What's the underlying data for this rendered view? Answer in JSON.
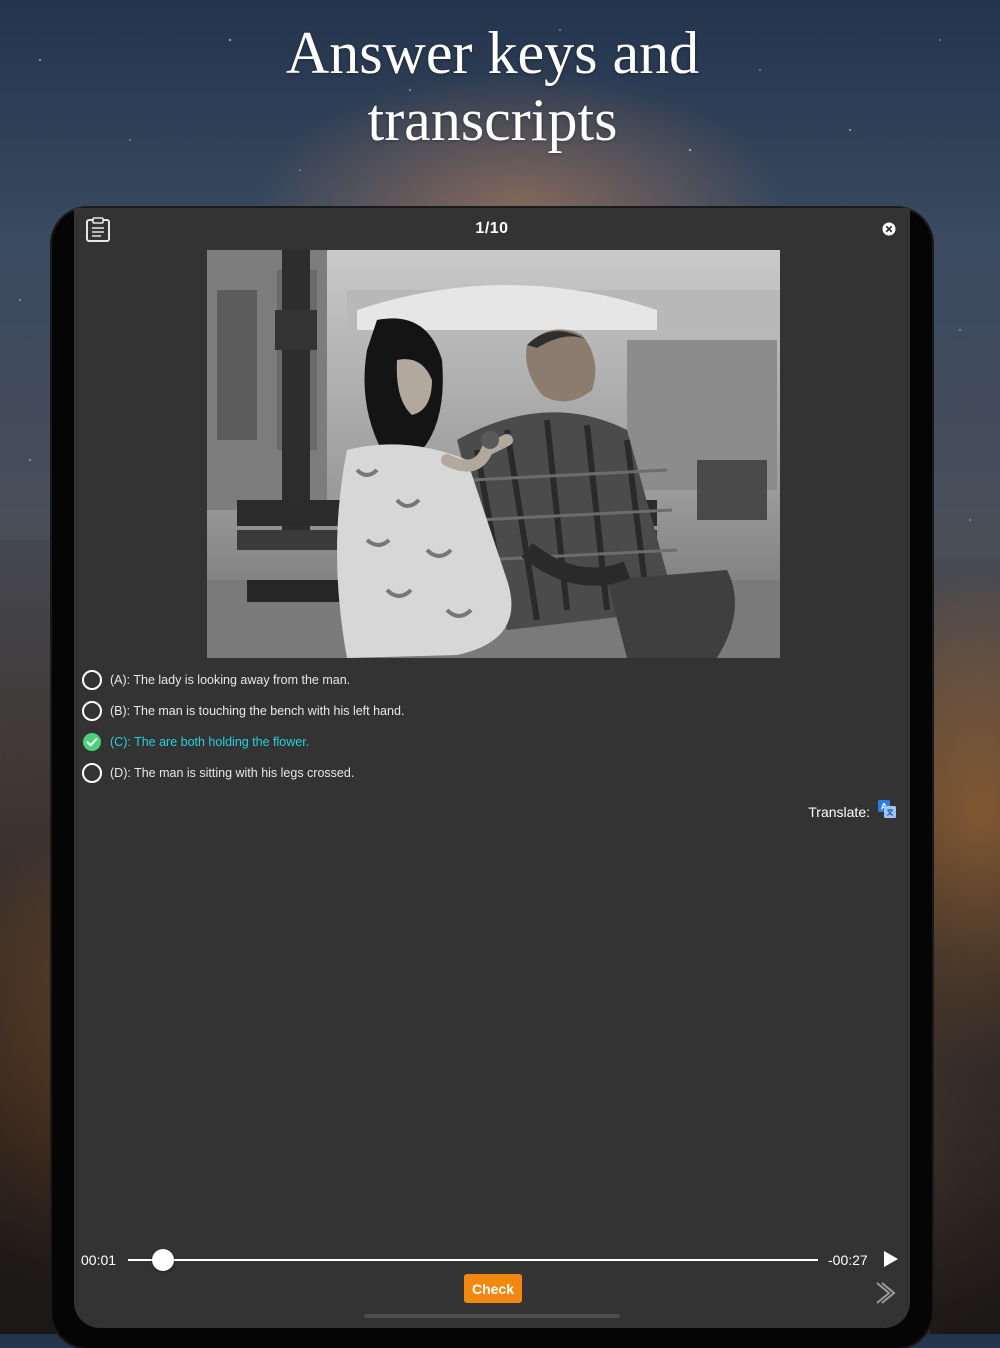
{
  "headline": {
    "line1": "Answer keys and",
    "line2": "transcripts"
  },
  "quiz": {
    "counter": "1/10",
    "photo_icon": "couple-on-bench-photo",
    "options": [
      {
        "label": "(A): The lady is looking away from the man.",
        "state": "unselected"
      },
      {
        "label": "(B): The man is touching the bench with his left hand.",
        "state": "unselected"
      },
      {
        "label": "(C): The are both holding the flower.",
        "state": "correct"
      },
      {
        "label": "(D): The man is sitting with his legs crossed.",
        "state": "unselected"
      }
    ],
    "translate_label": "Translate:"
  },
  "player": {
    "elapsed": "00:01",
    "remaining": "-00:27",
    "progress_fraction": 0.05
  },
  "actions": {
    "check_label": "Check"
  },
  "colors": {
    "screen_bg": "#333333",
    "correct_text": "#27d0df",
    "correct_check": "#4cd07a",
    "check_button": "#f2880f"
  },
  "icons": {
    "notes": "clipboard-icon",
    "close": "close-circle-icon",
    "translate": "translate-icon",
    "play": "play-icon",
    "next": "chevron-right-icon"
  }
}
